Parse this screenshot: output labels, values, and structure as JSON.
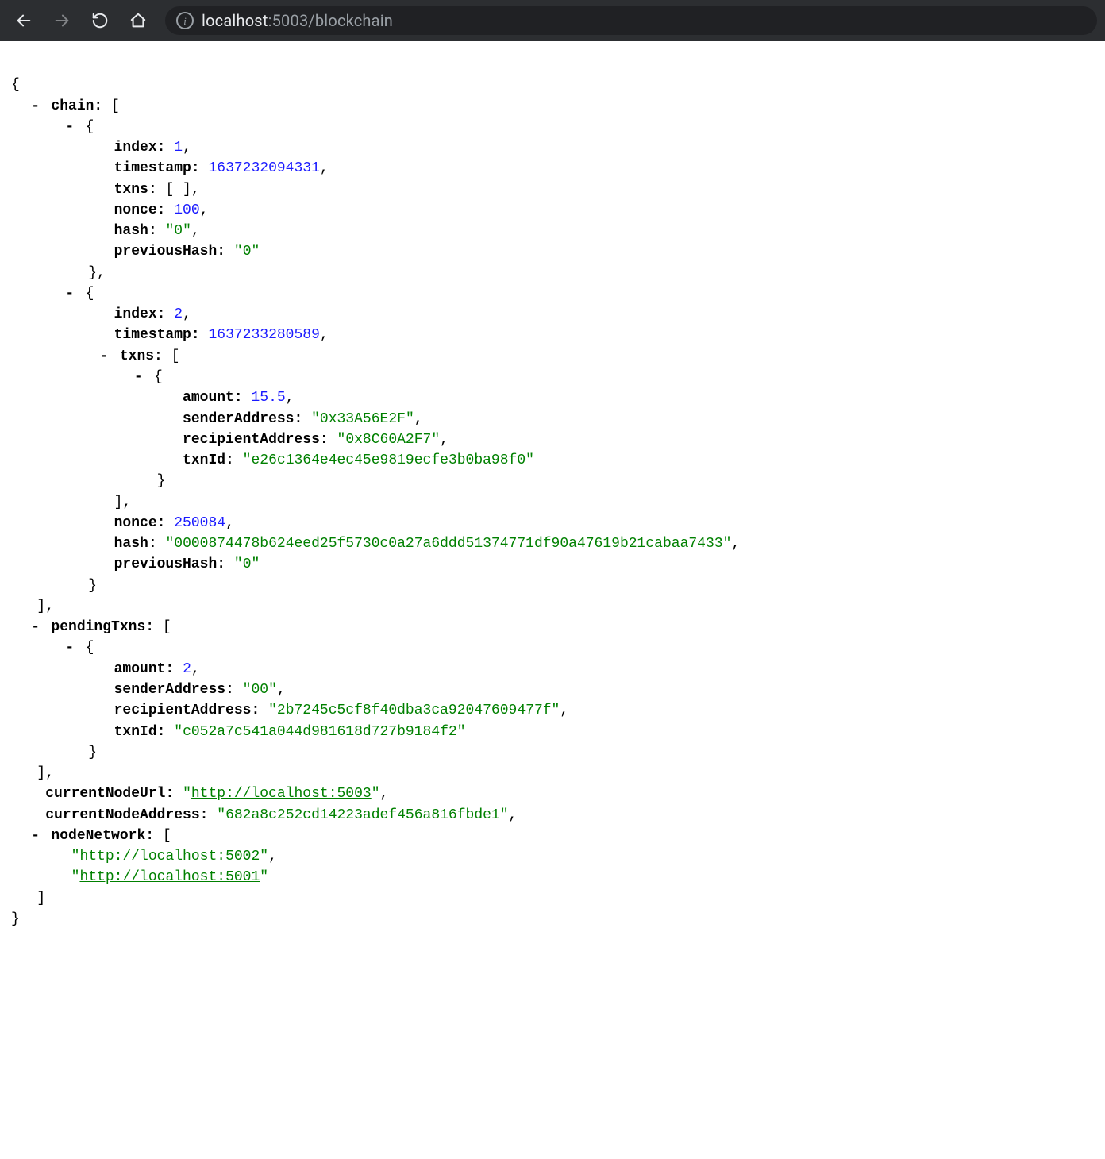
{
  "browser": {
    "url_host": "localhost",
    "url_port": ":5003",
    "url_path": "/blockchain"
  },
  "json": {
    "chain": [
      {
        "index": 1,
        "timestamp": 1637232094331,
        "txns": [],
        "nonce": 100,
        "hash": "0",
        "previousHash": "0"
      },
      {
        "index": 2,
        "timestamp": 1637233280589,
        "txns": [
          {
            "amount": 15.5,
            "senderAddress": "0x33A56E2F",
            "recipientAddress": "0x8C60A2F7",
            "txnId": "e26c1364e4ec45e9819ecfe3b0ba98f0"
          }
        ],
        "nonce": 250084,
        "hash": "0000874478b624eed25f5730c0a27a6ddd51374771df90a47619b21cabaa7433",
        "previousHash": "0"
      }
    ],
    "pendingTxns": [
      {
        "amount": 2,
        "senderAddress": "00",
        "recipientAddress": "2b7245c5cf8f40dba3ca92047609477f",
        "txnId": "c052a7c541a044d981618d727b9184f2"
      }
    ],
    "currentNodeUrl": "http://localhost:5003",
    "currentNodeAddress": "682a8c252cd14223adef456a816fbde1",
    "nodeNetwork": [
      "http://localhost:5002",
      "http://localhost:5001"
    ]
  },
  "labels": {
    "chain": "chain:",
    "index": "index:",
    "timestamp": "timestamp:",
    "txns": "txns:",
    "nonce": "nonce:",
    "hash": "hash:",
    "previousHash": "previousHash:",
    "amount": "amount:",
    "senderAddress": "senderAddress:",
    "recipientAddress": "recipientAddress:",
    "txnId": "txnId:",
    "pendingTxns": "pendingTxns:",
    "currentNodeUrl": "currentNodeUrl:",
    "currentNodeAddress": "currentNodeAddress:",
    "nodeNetwork": "nodeNetwork:"
  }
}
